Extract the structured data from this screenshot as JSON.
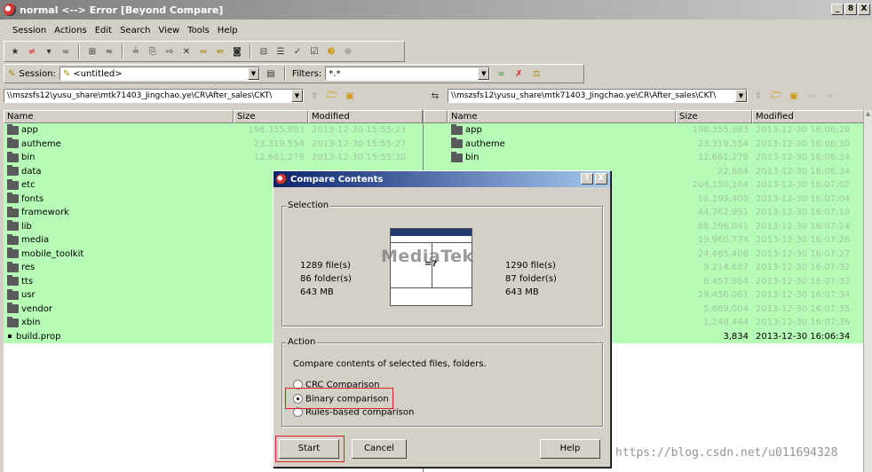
{
  "window": {
    "title": "normal <--> Error  [Beyond Compare]",
    "min": "_",
    "max": "8",
    "close": "X"
  },
  "menu": [
    "Session",
    "Actions",
    "Edit",
    "Search",
    "View",
    "Tools",
    "Help"
  ],
  "session": {
    "label": "Session:",
    "value": "<untitled>",
    "filters_label": "Filters:",
    "filters_value": "*.*"
  },
  "left_path": "\\\\mszsfs12\\yusu_share\\mtk71403_Jingchao.ye\\CR\\After_sales\\CKT\\",
  "right_path": "\\\\mszsfs12\\yusu_share\\mtk71403_Jingchao.ye\\CR\\After_sales\\CKT\\",
  "columns": {
    "name": "Name",
    "size": "Size",
    "modified": "Modified"
  },
  "left_rows": [
    {
      "name": "app",
      "size": "198,355,883",
      "date": "2013-12-30 15:55:23"
    },
    {
      "name": "autheme",
      "size": "23,319,554",
      "date": "2013-12-30 15:55:27"
    },
    {
      "name": "bin",
      "size": "12,661,279",
      "date": "2013-12-30 15:55:30"
    },
    {
      "name": "data",
      "size": "",
      "date": ""
    },
    {
      "name": "etc",
      "size": "204,",
      "date": ""
    },
    {
      "name": "fonts",
      "size": "16,",
      "date": ""
    },
    {
      "name": "framework",
      "size": "44,",
      "date": ""
    },
    {
      "name": "lib",
      "size": "88,",
      "date": ""
    },
    {
      "name": "media",
      "size": "19,",
      "date": ""
    },
    {
      "name": "mobile_toolkit",
      "size": "24,",
      "date": ""
    },
    {
      "name": "res",
      "size": "9,",
      "date": ""
    },
    {
      "name": "tts",
      "size": "6,",
      "date": ""
    },
    {
      "name": "usr",
      "size": "19,",
      "date": ""
    },
    {
      "name": "vendor",
      "size": "5,",
      "date": ""
    },
    {
      "name": "xbin",
      "size": "1,",
      "date": ""
    },
    {
      "name": "build.prop",
      "size": "",
      "date": "",
      "file": true
    }
  ],
  "right_rows": [
    {
      "name": "app",
      "size": "198,355,883",
      "date": "2013-12-30 16:06:28"
    },
    {
      "name": "autheme",
      "size": "23,319,554",
      "date": "2013-12-30 16:06:30"
    },
    {
      "name": "bin",
      "size": "12,661,279",
      "date": "2013-12-30 16:06:34"
    },
    {
      "name": "",
      "size": "22,884",
      "date": "2013-12-30 16:06:34"
    },
    {
      "name": "",
      "size": "204,150,104",
      "date": "2013-12-30 16:07:02"
    },
    {
      "name": "",
      "size": "16,199,400",
      "date": "2013-12-30 16:07:04"
    },
    {
      "name": "",
      "size": "44,762,991",
      "date": "2013-12-30 16:07:10"
    },
    {
      "name": "",
      "size": "88,296,041",
      "date": "2013-12-30 16:07:24"
    },
    {
      "name": "",
      "size": "19,960,774",
      "date": "2013-12-30 16:07:26"
    },
    {
      "name": "",
      "size": "24,465,408",
      "date": "2013-12-30 16:07:27"
    },
    {
      "name": "",
      "size": "9,214,687",
      "date": "2013-12-30 16:07:32"
    },
    {
      "name": "",
      "size": "6,457,984",
      "date": "2013-12-30 16:07:32"
    },
    {
      "name": "",
      "size": "19,456,061",
      "date": "2013-12-30 16:07:34"
    },
    {
      "name": "",
      "size": "5,869,004",
      "date": "2013-12-30 16:07:35"
    },
    {
      "name": "",
      "size": "1,248,444",
      "date": "2013-12-30 16:07:36"
    },
    {
      "name": "",
      "size": "3,834",
      "date": "2013-12-30 16:06:34",
      "dark": true
    }
  ],
  "dialog": {
    "title": "Compare Contents",
    "help_btn": "?",
    "close_btn": "X",
    "selection_label": "Selection",
    "left_files": "1289 file(s)",
    "left_folders": "86 folder(s)",
    "left_size": "643 MB",
    "right_files": "1290 file(s)",
    "right_folders": "87 folder(s)",
    "right_size": "643 MB",
    "diagram_symbol": "=?",
    "watermark": "MediaTek",
    "action_label": "Action",
    "action_text": "Compare contents of selected files, folders.",
    "options": [
      "CRC Comparison",
      "Binary comparison",
      "Rules-based comparison"
    ],
    "start": "Start",
    "cancel": "Cancel",
    "help": "Help"
  },
  "blog_watermark": "https://blog.csdn.net/u011694328"
}
